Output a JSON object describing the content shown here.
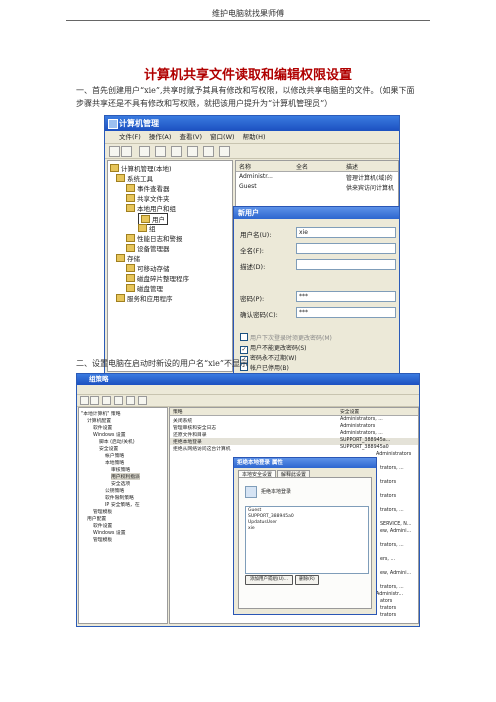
{
  "header": {
    "text": "维护电脑就找果师傅"
  },
  "doc": {
    "title": "计算机共享文件读取和编辑权限设置",
    "para1": "一、首先创建用户“xie”,共享时赋予其具有修改和写权限，以修改共享电脑里的文件。（如果下面步骤共享还是不具有修改和写权限，就把该用户提升为“计算机管理员”）",
    "para2": "二、设置电脑在启动时新设的用户名“xie”不显示"
  },
  "ss1": {
    "title": "计算机管理",
    "menu": "文件(F)  操作(A)  查看(V)  窗口(W)  帮助(H)",
    "tree": [
      "计算机管理(本地)",
      "系统工具",
      "事件查看器",
      "共享文件夹",
      "本地用户和组",
      "用户",
      "组",
      "性能日志和警报",
      "设备管理器",
      "存储",
      "可移动存储",
      "磁盘碎片整理程序",
      "磁盘管理",
      "服务和应用程序"
    ],
    "columns": [
      "名称",
      "全名",
      "描述"
    ],
    "rows": [
      {
        "name": "Administr...",
        "desc": "管理计算机(域)的"
      },
      {
        "name": "Guest",
        "desc": "供来宾访问计算机"
      }
    ],
    "dialog": {
      "title": "新用户",
      "username_label": "用户名(U):",
      "username_value": "xie",
      "fullname_label": "全名(F):",
      "desc_label": "描述(D):",
      "pw_label": "密码(P):",
      "pw_value": "***",
      "confirm_label": "确认密码(C):",
      "confirm_value": "***",
      "cb1": "用户下次登录时须更改密码(M)",
      "cb2": "用户不能更改密码(S)",
      "cb3": "密码永不过期(W)",
      "cb4": "帐户已停用(B)"
    }
  },
  "ss2": {
    "title": "组策略",
    "tree": [
      "\"本地计算机\" 策略",
      "计算机配置",
      "软件设置",
      "Windows 设置",
      "脚本 (启动/关机)",
      "安全设置",
      "帐户策略",
      "本地策略",
      "审核策略",
      "用户权利指派",
      "安全选项",
      "公钥策略",
      "软件限制策略",
      "IP 安全策略，在",
      "管理模板",
      "用户配置",
      "软件设置",
      "Windows 设置",
      "管理模板"
    ],
    "columns": [
      "策略",
      "安全设置"
    ],
    "rows": [
      {
        "policy": "关闭系统",
        "value": "Administrators, ..."
      },
      {
        "policy": "管理审核和安全日志",
        "value": "Administrators"
      },
      {
        "policy": "还原文件和目录",
        "value": "Administrators, ..."
      },
      {
        "policy": "拒绝本地登录",
        "value": "SUPPORT_388945a..."
      },
      {
        "policy": "拒绝从网络访问这台计算机",
        "value": "SUPPORT_388945a0"
      }
    ],
    "right_values": [
      "Administrators",
      "trators, ...",
      "trators",
      "trators",
      "trators, ...",
      "SERVICE, N...",
      "ew, Admini...",
      "trators, ...",
      "ers, ...",
      "ew, Admini...",
      "trators, ...",
      "Administr...",
      "ators",
      "trators",
      "trators",
      "trators, ..."
    ],
    "dialog": {
      "title": "拒绝本地登录 属性",
      "tab1": "本地安全设置",
      "tab2": "解释此设置",
      "heading": "拒绝本地登录",
      "users": [
        "Guest",
        "SUPPORT_388945a0",
        "UpdatusUser",
        "xie"
      ],
      "add_button": "添加用户或组(U)...",
      "remove_button": "删除(R)"
    }
  }
}
